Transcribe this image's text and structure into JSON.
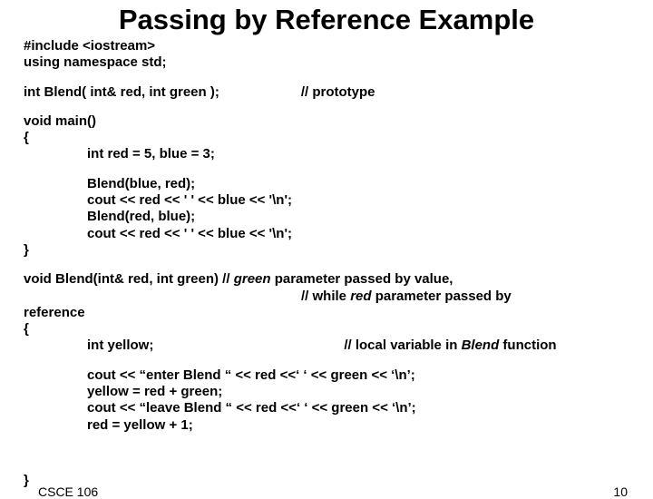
{
  "title": "Passing by Reference Example",
  "code": {
    "l1": "#include <iostream>",
    "l2": "using namespace std;",
    "l3a": "int Blend( int& red, int green );",
    "l3b": "// prototype",
    "l4": "void main()",
    "l5": "{",
    "l6": "int red = 5, blue = 3;",
    "l7": "Blend(blue, red);",
    "l8": "cout << red << ' ' << blue << '\\n';",
    "l9": "Blend(red, blue);",
    "l10": "cout << red << ' ' << blue << '\\n';",
    "l11": "}",
    "l12a": "void Blend(int& red, int green) // ",
    "l12b": "green",
    "l12c": " parameter passed by value,",
    "l13a": "// while ",
    "l13b": "red",
    "l13c": " parameter passed by ",
    "l14": "reference",
    "l15": "{",
    "l16a": "int yellow;",
    "l16b": "// local variable in ",
    "l16c": "Blend",
    "l16d": " function",
    "l17": "cout << “enter Blend “ << red <<‘ ‘ << green << ‘\\n’;",
    "l18": "yellow = red + green;",
    "l19": "cout << “leave Blend “ << red <<‘ ‘ << green << ‘\\n’;",
    "l20": "red = yellow + 1;",
    "l21": "}"
  },
  "footer": {
    "course": "CSCE 106",
    "page": "10"
  }
}
